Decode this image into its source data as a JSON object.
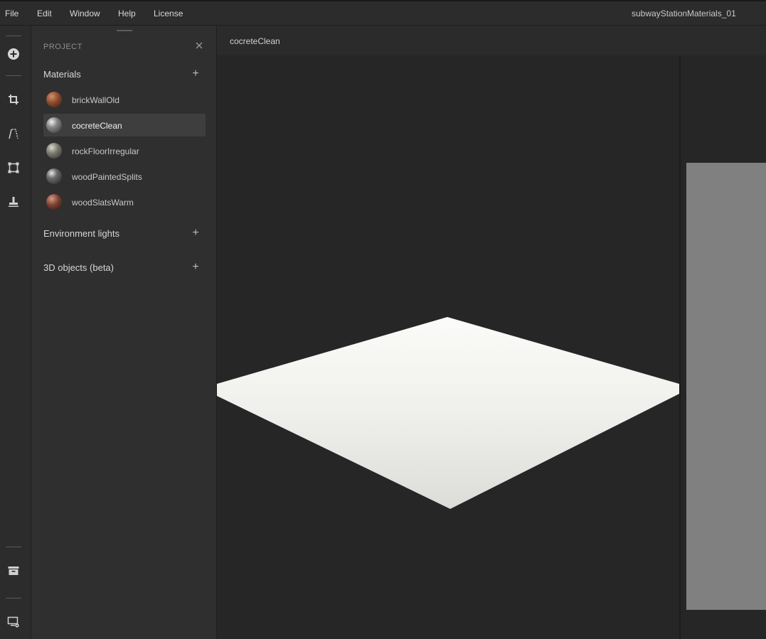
{
  "menu": {
    "file": "File",
    "edit": "Edit",
    "window": "Window",
    "help": "Help",
    "license": "License"
  },
  "document_title": "subwayStationMaterials_01",
  "toolbar": {
    "icons": [
      "add-circle-icon",
      "crop-icon",
      "perspective-icon",
      "transform-icon",
      "stamp-icon",
      "archive-icon",
      "display-settings-icon"
    ]
  },
  "panel": {
    "title": "PROJECT",
    "materials_label": "Materials",
    "materials": [
      {
        "label": "brickWallOld",
        "color": "#8a4a2e"
      },
      {
        "label": "cocreteClean",
        "color": "#6a6a6a",
        "selected": true
      },
      {
        "label": "rockFloorIrregular",
        "color": "#7a7a72"
      },
      {
        "label": "woodPaintedSplits",
        "color": "#5e5e5e"
      },
      {
        "label": "woodSlatsWarm",
        "color": "#7a4030"
      }
    ],
    "environment_label": "Environment lights",
    "objects_label": "3D objects (beta)",
    "add_symbol": "+"
  },
  "viewport": {
    "tab_label": "cocreteClean"
  },
  "colors": {
    "background": "#262626",
    "panel": "#2f2f2f",
    "preview_gray": "#808080"
  }
}
